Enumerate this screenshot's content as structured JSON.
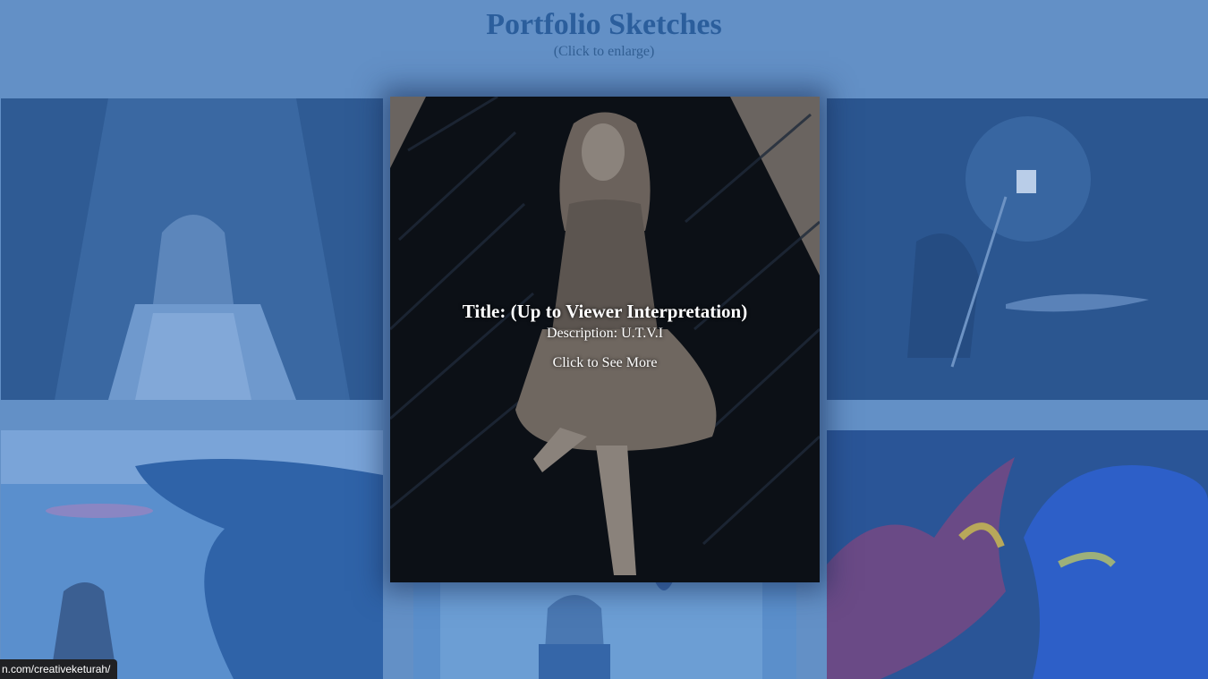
{
  "header": {
    "title": "Portfolio Sketches",
    "subtitle": "(Click to enlarge)"
  },
  "featured": {
    "title": "Title: (Up to Viewer Interpretation)",
    "description": "Description: U.T.V.I",
    "cta": "Click to See More"
  },
  "status_bar": {
    "url": "n.com/creativeketurah/"
  },
  "colors": {
    "page_background": "#6390c6",
    "title_text": "#2b5e9c",
    "overlay_text": "#ffffff",
    "status_bar_bg": "#202124"
  }
}
